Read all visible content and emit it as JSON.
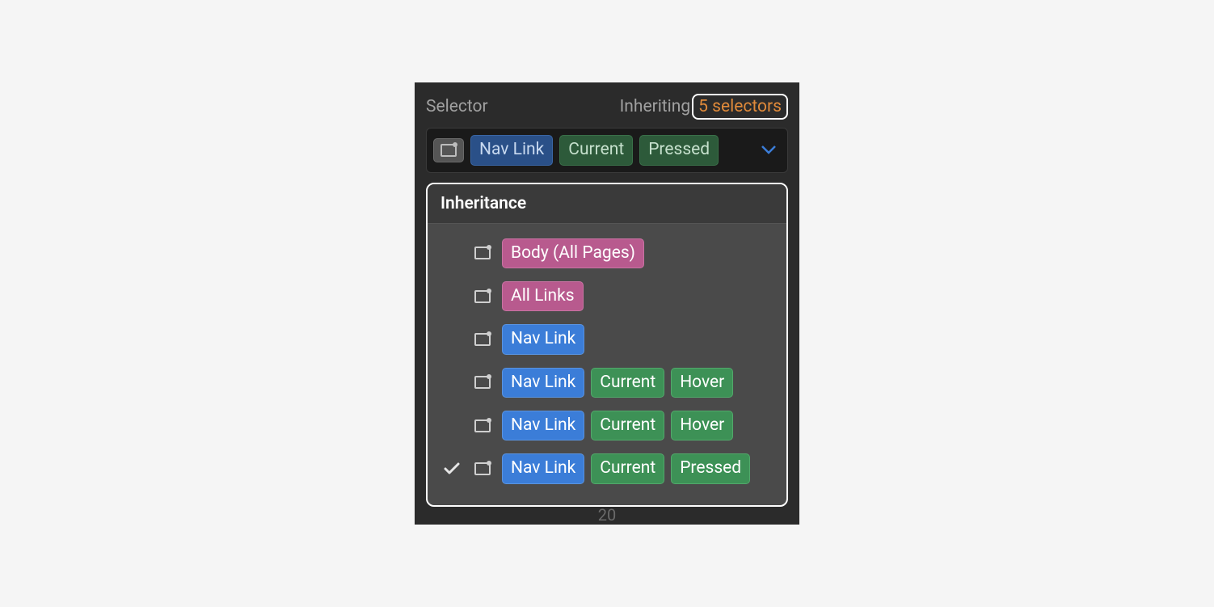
{
  "header": {
    "selector_label": "Selector",
    "inheriting_label": "Inheriting",
    "inheriting_count": "5 selectors"
  },
  "selector_field": {
    "tags": [
      {
        "kind": "icon",
        "variant": "gray"
      },
      {
        "kind": "text",
        "label": "Nav Link",
        "variant": "darkblue"
      },
      {
        "kind": "text",
        "label": "Current",
        "variant": "darkgreen"
      },
      {
        "kind": "text",
        "label": "Pressed",
        "variant": "darkgreen"
      }
    ]
  },
  "popover": {
    "title": "Inheritance",
    "rows": [
      {
        "checked": false,
        "tags": [
          {
            "label": "Body (All Pages)",
            "variant": "pink"
          }
        ]
      },
      {
        "checked": false,
        "tags": [
          {
            "label": "All Links",
            "variant": "pink"
          }
        ]
      },
      {
        "checked": false,
        "tags": [
          {
            "label": "Nav Link",
            "variant": "blue"
          }
        ]
      },
      {
        "checked": false,
        "tags": [
          {
            "label": "Nav Link",
            "variant": "blue"
          },
          {
            "label": "Current",
            "variant": "green"
          },
          {
            "label": "Hover",
            "variant": "green"
          }
        ]
      },
      {
        "checked": false,
        "tags": [
          {
            "label": "Nav Link",
            "variant": "blue"
          },
          {
            "label": "Current",
            "variant": "green"
          },
          {
            "label": "Hover",
            "variant": "green"
          }
        ]
      },
      {
        "checked": true,
        "tags": [
          {
            "label": "Nav Link",
            "variant": "blue"
          },
          {
            "label": "Current",
            "variant": "green"
          },
          {
            "label": "Pressed",
            "variant": "green"
          }
        ]
      }
    ]
  },
  "footer_number": "20"
}
